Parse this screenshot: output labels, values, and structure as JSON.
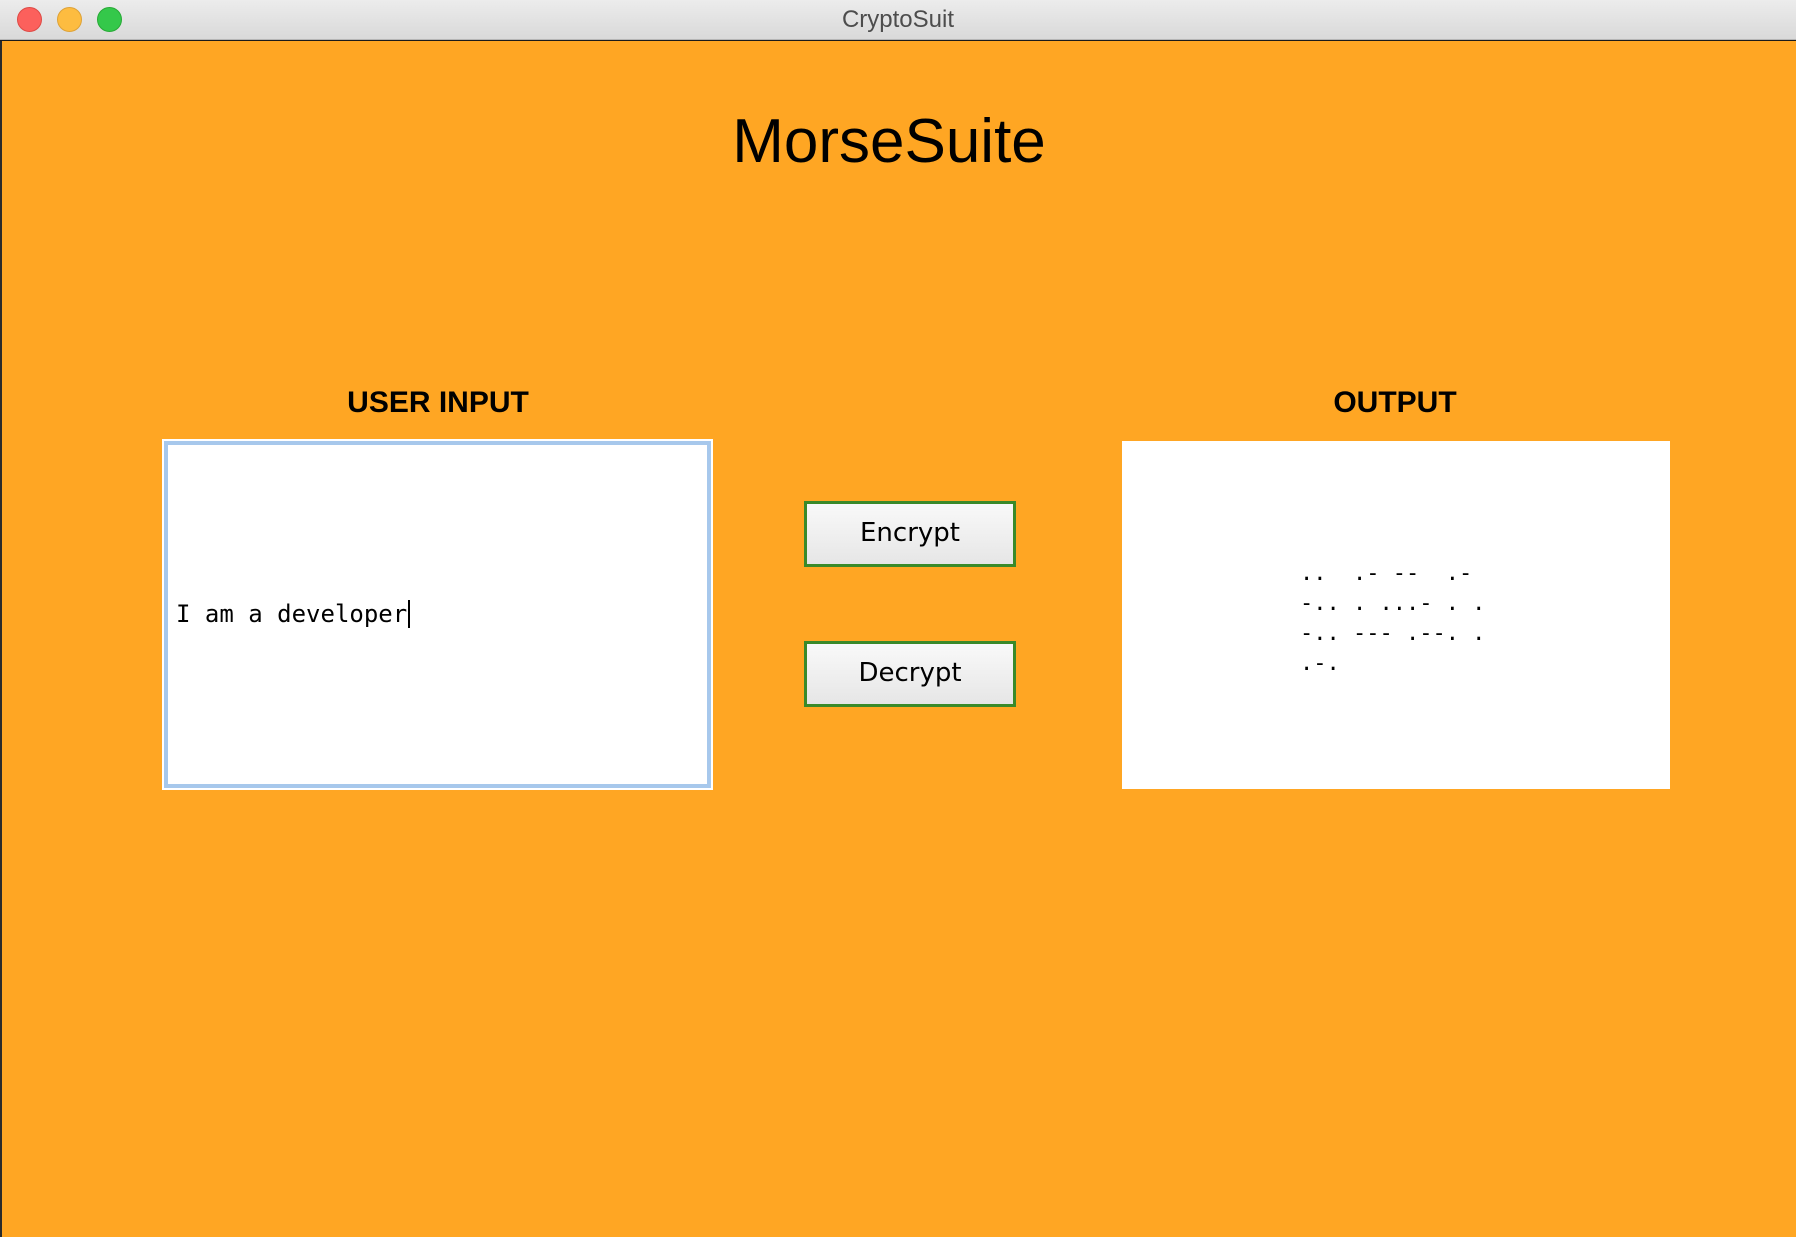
{
  "window": {
    "title": "CryptoSuit"
  },
  "app": {
    "title": "MorseSuite",
    "background_color": "#ffa623"
  },
  "input_section": {
    "label": "USER INPUT",
    "value": "I am a developer"
  },
  "buttons": {
    "encrypt_label": "Encrypt",
    "decrypt_label": "Decrypt"
  },
  "output_section": {
    "label": "OUTPUT",
    "lines": [
      "..  .- --  .-",
      "-.. . ...- . .",
      "-.. --- .--. .",
      ".-."
    ]
  }
}
